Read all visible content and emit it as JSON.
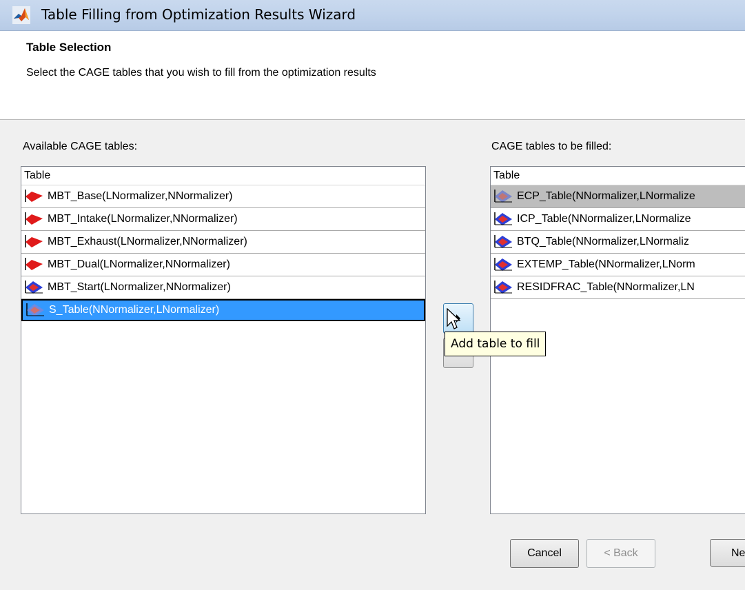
{
  "window": {
    "title": "Table Filling from Optimization Results Wizard"
  },
  "header": {
    "title": "Table Selection",
    "description": "Select the CAGE tables that you wish to fill from the optimization results"
  },
  "available": {
    "label": "Available CAGE tables:",
    "column_header": "Table",
    "items": [
      {
        "label": "MBT_Base(LNormalizer,NNormalizer)",
        "icon": "feature-icon"
      },
      {
        "label": "MBT_Intake(LNormalizer,NNormalizer)",
        "icon": "feature-icon"
      },
      {
        "label": "MBT_Exhaust(LNormalizer,NNormalizer)",
        "icon": "feature-icon"
      },
      {
        "label": "MBT_Dual(LNormalizer,NNormalizer)",
        "icon": "feature-icon"
      },
      {
        "label": "MBT_Start(LNormalizer,NNormalizer)",
        "icon": "table-icon"
      },
      {
        "label": "S_Table(NNormalizer,LNormalizer)",
        "icon": "table-icon",
        "selected": true
      }
    ]
  },
  "to_fill": {
    "label": "CAGE tables to be filled:",
    "column_header": "Table",
    "items": [
      {
        "label": "ECP_Table(NNormalizer,LNormalize",
        "icon": "table-icon",
        "highlighted": true
      },
      {
        "label": "ICP_Table(NNormalizer,LNormalize",
        "icon": "table-icon"
      },
      {
        "label": "BTQ_Table(NNormalizer,LNormaliz",
        "icon": "table-icon"
      },
      {
        "label": "EXTEMP_Table(NNormalizer,LNorm",
        "icon": "table-icon"
      },
      {
        "label": "RESIDFRAC_Table(NNormalizer,LN",
        "icon": "table-icon"
      }
    ]
  },
  "tooltip": {
    "text": "Add table to fill"
  },
  "buttons": {
    "cancel": "Cancel",
    "back": "< Back",
    "next": "Ne"
  },
  "colors": {
    "selection": "#3399ff",
    "titlebar": "#c4d6ec"
  }
}
